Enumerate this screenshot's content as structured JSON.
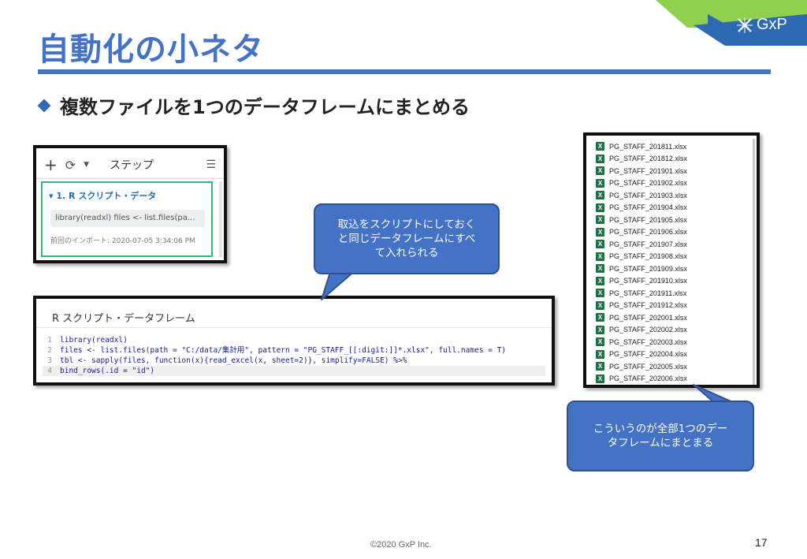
{
  "slide": {
    "title": "自動化の小ネタ",
    "bullet": "複数ファイルを1つのデータフレームにまとめる",
    "logo": "GxP",
    "footer": "©2020 GxP Inc.",
    "page_number": "17"
  },
  "steps_panel": {
    "toolbar_label": "ステップ",
    "step_title": "▾ 1. R スクリプト・データ",
    "step_code": "library(readxl) files <- list.files(pa...",
    "step_meta": "前回のインポート: 2020-07-05 3:34:06 PM"
  },
  "editor": {
    "title": "R スクリプト・データフレーム",
    "lines": [
      {
        "num": "1",
        "code": "library(readxl)"
      },
      {
        "num": "2",
        "code": "files <- list.files(path = \"C:/data/集計用\", pattern = \"PG_STAFF_[[:digit:]]*.xlsx\", full.names = T)"
      },
      {
        "num": "3",
        "code": "tbl <- sapply(files, function(x){read_excel(x, sheet=2)}, simplify=FALSE) %>%"
      },
      {
        "num": "4",
        "code": "bind_rows(.id = \"id\")"
      }
    ]
  },
  "files": [
    "PG_STAFF_201811.xlsx",
    "PG_STAFF_201812.xlsx",
    "PG_STAFF_201901.xlsx",
    "PG_STAFF_201902.xlsx",
    "PG_STAFF_201903.xlsx",
    "PG_STAFF_201904.xlsx",
    "PG_STAFF_201905.xlsx",
    "PG_STAFF_201906.xlsx",
    "PG_STAFF_201907.xlsx",
    "PG_STAFF_201908.xlsx",
    "PG_STAFF_201909.xlsx",
    "PG_STAFF_201910.xlsx",
    "PG_STAFF_201911.xlsx",
    "PG_STAFF_201912.xlsx",
    "PG_STAFF_202001.xlsx",
    "PG_STAFF_202002.xlsx",
    "PG_STAFF_202003.xlsx",
    "PG_STAFF_202004.xlsx",
    "PG_STAFF_202005.xlsx",
    "PG_STAFF_202006.xlsx"
  ],
  "callouts": {
    "script_note": "取込をスクリプトにしておく\nと同じデータフレームにすべ\nて入れられる",
    "files_note": "こういうのが全部1つのデー\nタフレームにまとまる"
  },
  "colors": {
    "accent": "#4472c4",
    "corner_green": "#8fd14f",
    "step_border": "#33b97a",
    "excel_green": "#1e7145"
  }
}
